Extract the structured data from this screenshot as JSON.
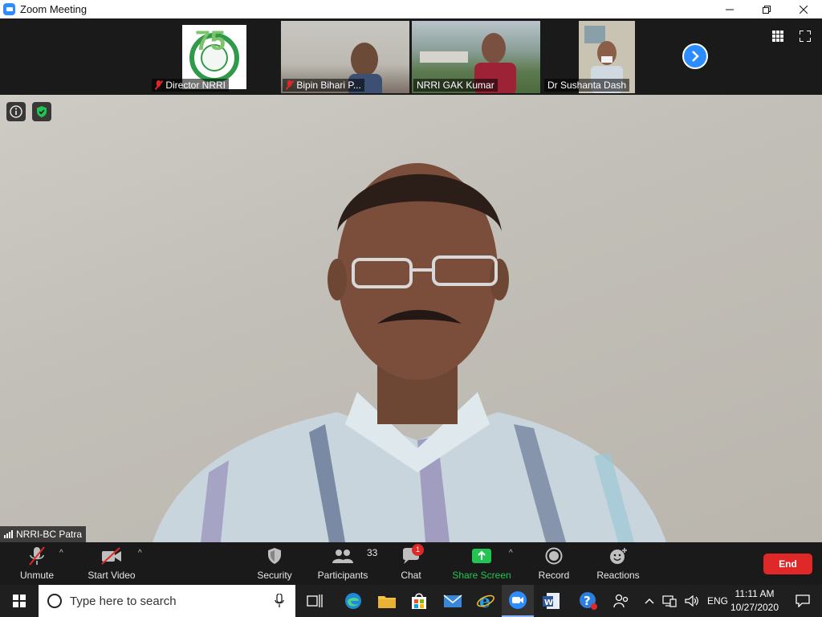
{
  "window": {
    "title": "Zoom Meeting"
  },
  "participants_strip": [
    {
      "name": "Director NRRI",
      "muted": true,
      "logo_text": "75"
    },
    {
      "name": "Bipin Bihari P...",
      "muted": true
    },
    {
      "name": "NRRI GAK Kumar",
      "muted": false
    },
    {
      "name": "Dr Sushanta Dash",
      "muted": false
    }
  ],
  "main_video": {
    "speaker_name": "NRRI-BC Patra"
  },
  "toolbar": {
    "unmute": "Unmute",
    "start_video": "Start Video",
    "security": "Security",
    "participants": "Participants",
    "participants_count": "33",
    "chat": "Chat",
    "chat_badge": "1",
    "share_screen": "Share Screen",
    "record": "Record",
    "reactions": "Reactions",
    "end": "End"
  },
  "taskbar": {
    "search_placeholder": "Type here to search",
    "language": "ENG",
    "time": "11:11 AM",
    "date": "10/27/2020"
  },
  "colors": {
    "accent_blue": "#2d8cff",
    "share_green": "#23c552",
    "end_red": "#e02828",
    "muted_red": "#e02828"
  }
}
